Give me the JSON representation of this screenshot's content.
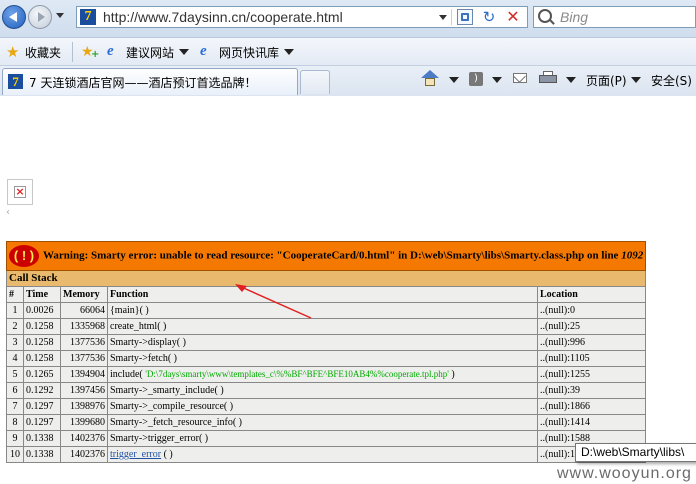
{
  "address_bar": {
    "logo_glyph": "7",
    "url": "http://www.7daysinn.cn/cooperate.html",
    "search_placeholder": "Bing",
    "refresh_glyph": "↻",
    "stop_glyph": "✕"
  },
  "favorites_bar": {
    "favorites_label": "收藏夹",
    "items": [
      {
        "label": "建议网站",
        "icon": "ie-icon"
      },
      {
        "label": "网页快讯库",
        "icon": "ie-icon"
      }
    ],
    "ie_glyph": "e"
  },
  "tab_bar": {
    "active_tab_title": "7 天连锁酒店官网——酒店预订首选品牌！",
    "tab_logo_glyph": "7",
    "commands": {
      "page_label": "页面(P)",
      "safety_label": "安全(S)",
      "rss_glyph": ")"
    }
  },
  "content": {
    "broken_image_glyph": "×",
    "caret_glyph": "‹",
    "error": {
      "badge": "( ! )",
      "message": "Warning: Smarty error: unable to read resource: \"CooperateCard/0.html\" in D:\\web\\Smarty\\libs\\Smarty.class.php on line ",
      "line": "1092",
      "call_stack_title": "Call Stack",
      "columns": [
        "#",
        "Time",
        "Memory",
        "Function",
        "Location"
      ],
      "rows": [
        {
          "num": "1",
          "time": "0.0026",
          "memory": "66064",
          "func": "{main}( )",
          "location": "..(null):0"
        },
        {
          "num": "2",
          "time": "0.1258",
          "memory": "1335968",
          "func": "create_html( )",
          "location": "..(null):25"
        },
        {
          "num": "3",
          "time": "0.1258",
          "memory": "1377536",
          "func": "Smarty->display( )",
          "location": "..(null):996"
        },
        {
          "num": "4",
          "time": "0.1258",
          "memory": "1377536",
          "func": "Smarty->fetch( )",
          "location": "..(null):1105"
        },
        {
          "num": "5",
          "time": "0.1265",
          "memory": "1394904",
          "func": "include( ",
          "func_arg": "'D:\\7days\\smarty\\www\\templates_c\\%%BF^BFE^BFE10AB4%%cooperate.tpl.php'",
          "func_end": " )",
          "location": "..(null):1255"
        },
        {
          "num": "6",
          "time": "0.1292",
          "memory": "1397456",
          "func": "Smarty->_smarty_include( )",
          "location": "..(null):39"
        },
        {
          "num": "7",
          "time": "0.1297",
          "memory": "1398976",
          "func": "Smarty->_compile_resource( )",
          "location": "..(null):1866"
        },
        {
          "num": "8",
          "time": "0.1297",
          "memory": "1399680",
          "func": "Smarty->_fetch_resource_info( )",
          "location": "..(null):1414"
        },
        {
          "num": "9",
          "time": "0.1338",
          "memory": "1402376",
          "func": "Smarty->trigger_error( )",
          "location": "..(null):1588"
        },
        {
          "num": "10",
          "time": "0.1338",
          "memory": "1402376",
          "func": "trigger_error",
          "func_end": " ( )",
          "location": "..(null):1"
        }
      ]
    },
    "tooltip": "D:\\web\\Smarty\\libs\\",
    "watermark": "www.wooyun.org"
  },
  "colors": {
    "error_header_bg": "#f57900",
    "error_badge": "#cc0000",
    "call_stack_bg": "#e9b96e",
    "row_bg": "#eeeeec",
    "arg_green": "#00aa00",
    "arrow_red": "#e02020"
  }
}
